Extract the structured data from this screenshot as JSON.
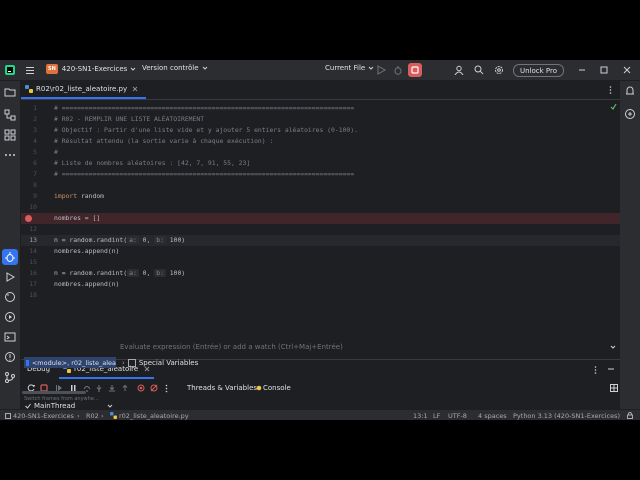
{
  "colors": {
    "accent": "#3574f0",
    "breakpoint": "#db5c5c",
    "stop": "#db5c5c",
    "project_badge": "#e0713a"
  },
  "titlebar": {
    "project_badge": "SN",
    "project_name": "420-SN1-Exercices",
    "vcs": "Version contrôle",
    "run_config": "Current File",
    "unlock": "Unlock Pro"
  },
  "editor": {
    "tab_label": "R02\\r02_liste_aleatoire.py",
    "lines": [
      {
        "n": "1",
        "code": "# ============================================================================",
        "kind": "comment"
      },
      {
        "n": "2",
        "code": "# R02 - REMPLIR UNE LISTE ALÉATOIREMENT",
        "kind": "comment"
      },
      {
        "n": "3",
        "code": "# Objectif : Partir d'une liste vide et y ajouter 5 entiers aléatoires (0-100).",
        "kind": "comment"
      },
      {
        "n": "4",
        "code": "# Résultat attendu (la sortie varie à chaque exécution) :",
        "kind": "comment"
      },
      {
        "n": "5",
        "code": "#",
        "kind": "comment"
      },
      {
        "n": "6",
        "code": "# Liste de nombres aléatoires : [42, 7, 91, 55, 23]",
        "kind": "comment"
      },
      {
        "n": "7",
        "code": "# ============================================================================",
        "kind": "comment"
      },
      {
        "n": "8",
        "code": "",
        "kind": "plain"
      },
      {
        "n": "9",
        "kw": "import",
        "code": " random",
        "kind": "keyword"
      },
      {
        "n": "10",
        "code": "",
        "kind": "plain"
      },
      {
        "n": "11",
        "code": "nombres = []",
        "kind": "breakpoint"
      },
      {
        "n": "12",
        "code": "",
        "kind": "plain"
      },
      {
        "n": "13",
        "code": "n = random.randint(",
        "hint1": "a:",
        "v1": " 0,",
        "hint2": "b:",
        "v2": " 100)",
        "kind": "current"
      },
      {
        "n": "14",
        "code": "nombres.append(n)",
        "kind": "plain"
      },
      {
        "n": "15",
        "code": "",
        "kind": "plain"
      },
      {
        "n": "16",
        "code": "n = random.randint(",
        "hint1": "a:",
        "v1": " 0,",
        "hint2": "b:",
        "v2": " 100)",
        "kind": "plain"
      },
      {
        "n": "17",
        "code": "nombres.append(n)",
        "kind": "plain"
      },
      {
        "n": "18",
        "code": "",
        "kind": "plain"
      }
    ]
  },
  "debug": {
    "title": "Debug",
    "session_tab": "r02_liste_aleatoire",
    "threads_tab": "Threads & Variables",
    "console_tab": "Console",
    "thread": "MainThread",
    "frame": "<module>, r02_liste_alea",
    "eval_placeholder": "Evaluate expression (Entrée) or add a watch (Ctrl+Maj+Entrée)",
    "special_vars": "Special Variables",
    "switch_hint": "Switch frames from anywhe..."
  },
  "statusbar": {
    "crumbs": [
      "420-SN1-Exercices",
      "R02",
      "r02_liste_aleatoire.py"
    ],
    "position": "13:1",
    "line_sep": "LF",
    "encoding": "UTF-8",
    "indent": "4 spaces",
    "interpreter": "Python 3.13 (420-SN1-Exercices)"
  }
}
